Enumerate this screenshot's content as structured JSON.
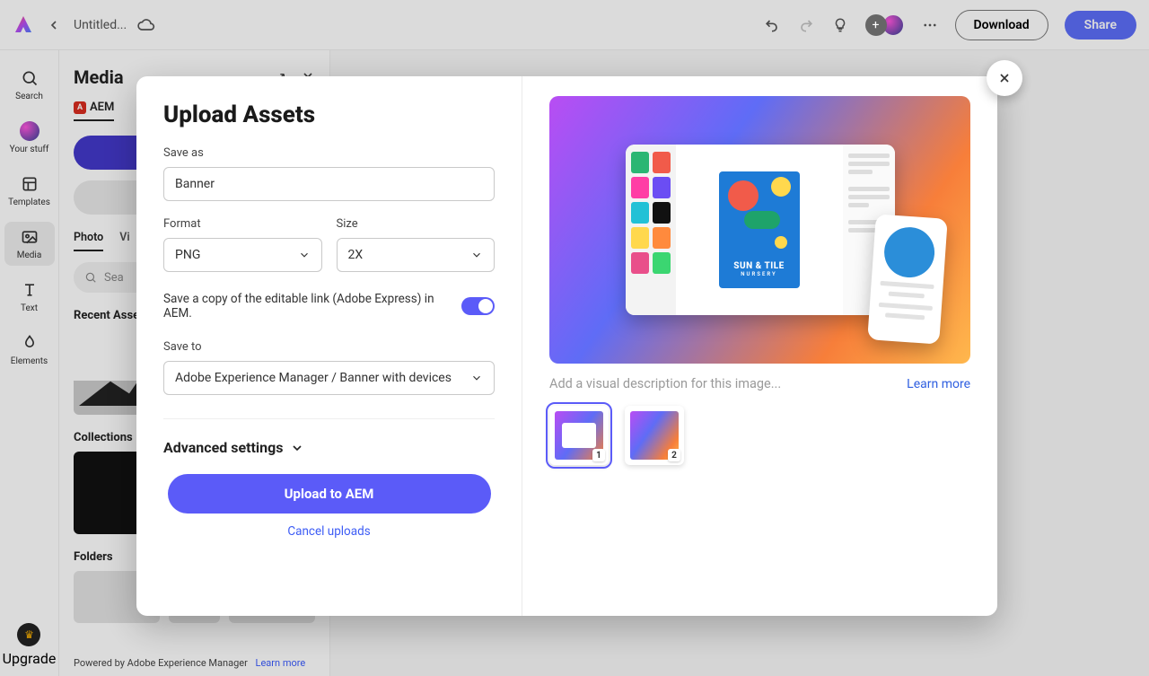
{
  "topbar": {
    "doc_title": "Untitled...",
    "download_label": "Download",
    "share_label": "Share"
  },
  "rail": {
    "search": "Search",
    "your_stuff": "Your stuff",
    "templates": "Templates",
    "media": "Media",
    "text": "Text",
    "elements": "Elements",
    "upgrade": "Upgrade"
  },
  "media_panel": {
    "title": "Media",
    "tab_aem": "AEM",
    "subtab_photo": "Photo",
    "subtab_video": "Vi",
    "search_placeholder": "Sea",
    "recent_label": "Recent Asse",
    "collections_label": "Collections",
    "folders_label": "Folders",
    "footer_text": "Powered by Adobe Experience Manager",
    "footer_link": "Learn more"
  },
  "modal": {
    "title": "Upload Assets",
    "save_as_label": "Save as",
    "save_as_value": "Banner",
    "format_label": "Format",
    "format_value": "PNG",
    "size_label": "Size",
    "size_value": "2X",
    "toggle_label": "Save a copy of the editable link (Adobe Express) in AEM.",
    "save_to_label": "Save to",
    "save_to_value": "Adobe Experience Manager / Banner with devices",
    "advanced_label": "Advanced settings",
    "upload_btn": "Upload to AEM",
    "cancel_link": "Cancel uploads",
    "poster_line1": "SUN & TILE",
    "poster_line2": "NURSERY",
    "desc_placeholder": "Add a visual description for this image...",
    "learn_more": "Learn more",
    "thumb1_badge": "1",
    "thumb2_badge": "2"
  }
}
